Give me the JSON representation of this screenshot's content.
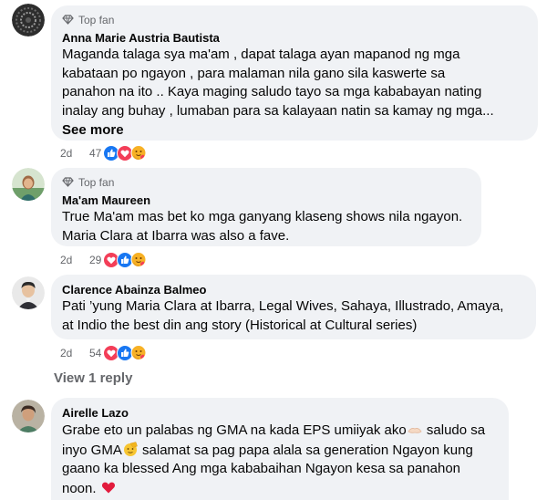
{
  "comments": [
    {
      "badge": "Top fan",
      "name": "Anna Marie Austria Bautista",
      "lines": [
        "Maganda talaga sya ma'am , dapat talaga ayan mapanod ng mga",
        "kabataan po ngayon , para malaman nila gano sila kaswerte sa",
        "panahon na ito .. Kaya maging saludo tayo sa mga kababayan nating",
        "inalay ang buhay , lumaban para sa kalayaan natin sa kamay ng mga..."
      ],
      "see_more": "See more",
      "time": "2d",
      "reaction_count": "47",
      "reactions": [
        "like-icon",
        "love-icon",
        "care-icon"
      ]
    },
    {
      "badge": "Top fan",
      "name": "Ma'am Maureen",
      "lines": [
        "True Ma'am mas bet ko mga ganyang klaseng shows nila ngayon.",
        "Maria Clara at Ibarra was also a fave."
      ],
      "time": "2d",
      "reaction_count": "29",
      "reactions": [
        "love-icon",
        "like-icon",
        "care-icon"
      ]
    },
    {
      "name": "Clarence Abainza Balmeo",
      "lines": [
        "Pati ’yung Maria Clara at Ibarra, Legal Wives, Sahaya, Illustrado, Amaya,",
        "at Indio the best din ang story (Historical at Cultural series)"
      ],
      "time": "2d",
      "reaction_count": "54",
      "reactions": [
        "love-icon",
        "like-icon",
        "care-icon"
      ]
    },
    {
      "name": "Airelle Lazo",
      "line1": "Grabe eto un palabas ng GMA na kada EPS umiiyak ako",
      "line1_tail": " saludo sa",
      "line2_a": "inyo GMA",
      "line2_b": " salamat sa pag papa alala sa generation Ngayon kung",
      "line3": "gaano ka blessed Ang mga kababaihan Ngayon kesa sa panahon",
      "line4": "noon."
    }
  ],
  "view_reply": "View 1 reply",
  "colors": {
    "bubble": "#f0f2f5",
    "muted": "#65676b",
    "like": "#1877f2",
    "love": "#f33e58"
  }
}
